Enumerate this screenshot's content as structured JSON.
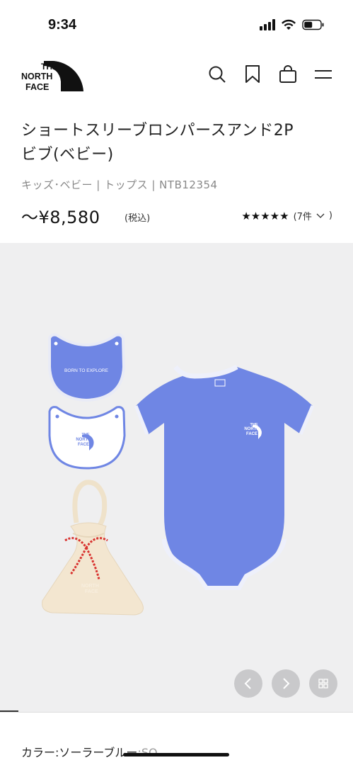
{
  "status": {
    "time": "9:34"
  },
  "header": {
    "logo_lines": [
      "THE",
      "NORTH",
      "FACE"
    ],
    "icons": [
      "search-icon",
      "bookmark-icon",
      "bag-icon",
      "menu-icon"
    ]
  },
  "product": {
    "title_line1": "ショートスリーブロンパースアンド2P",
    "title_line2": "ビブ(ベビー)",
    "breadcrumb": "キッズ･ベビー | トップス | NTB12354",
    "price": "〜¥8,580",
    "tax_note": "(税込)",
    "stars": "★★★★★",
    "review_count": "(7件",
    "rating_value": 5
  },
  "gallery": {
    "bib_text": "BORN TO EXPLORE",
    "logo_text": [
      "THE",
      "NORTH",
      "FACE"
    ],
    "accent_color": "#6f86e4",
    "bag_color": "#f3e6d0",
    "prev_icon": "chevron-left-icon",
    "next_icon": "chevron-right-icon",
    "grid_icon": "grid-icon"
  },
  "color_select": {
    "label": "カラー:ソーラーブルー",
    "code": ":SO"
  }
}
